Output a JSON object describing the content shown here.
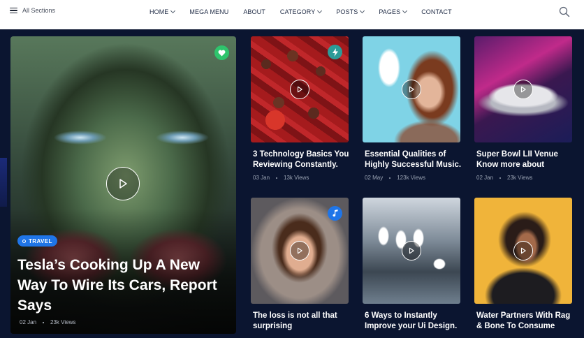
{
  "header": {
    "all_sections_label": "All Sections",
    "nav": [
      {
        "label": "HOME",
        "has_dropdown": true
      },
      {
        "label": "MEGA MENU",
        "has_dropdown": false
      },
      {
        "label": "ABOUT",
        "has_dropdown": false
      },
      {
        "label": "CATEGORY",
        "has_dropdown": true
      },
      {
        "label": "POSTS",
        "has_dropdown": true
      },
      {
        "label": "PAGES",
        "has_dropdown": true
      },
      {
        "label": "CONTACT",
        "has_dropdown": false
      }
    ]
  },
  "hero": {
    "badge_icon": "heart-icon",
    "tag": "TRAVEL",
    "title": "Tesla’s Cooking Up A New Way To Wire Its Cars, Report Says",
    "date": "02 Jan",
    "views": "23k Views"
  },
  "cards": [
    {
      "title": "3 Technology Basics You Reviewing Constantly.",
      "date": "03 Jan",
      "views": "13k Views",
      "badge_icon": "lightning-icon"
    },
    {
      "title": "Essential Qualities of Highly Successful Music.",
      "date": "02 May",
      "views": "123k Views",
      "badge_icon": ""
    },
    {
      "title": "Super Bowl LII Venue Know more about",
      "date": "02 Jan",
      "views": "23k Views",
      "badge_icon": ""
    },
    {
      "title": "The loss is not all that surprising",
      "date": "",
      "views": "",
      "badge_icon": "music-note-icon"
    },
    {
      "title": "6 Ways to Instantly Improve your Ui Design.",
      "date": "",
      "views": "",
      "badge_icon": ""
    },
    {
      "title": "Water Partners With Rag & Bone To Consume",
      "date": "",
      "views": "",
      "badge_icon": ""
    }
  ],
  "colors": {
    "background": "#0b1530",
    "accent_blue": "#1f75e8",
    "badge_green": "#2ec46c",
    "badge_teal": "#2c9b98"
  }
}
